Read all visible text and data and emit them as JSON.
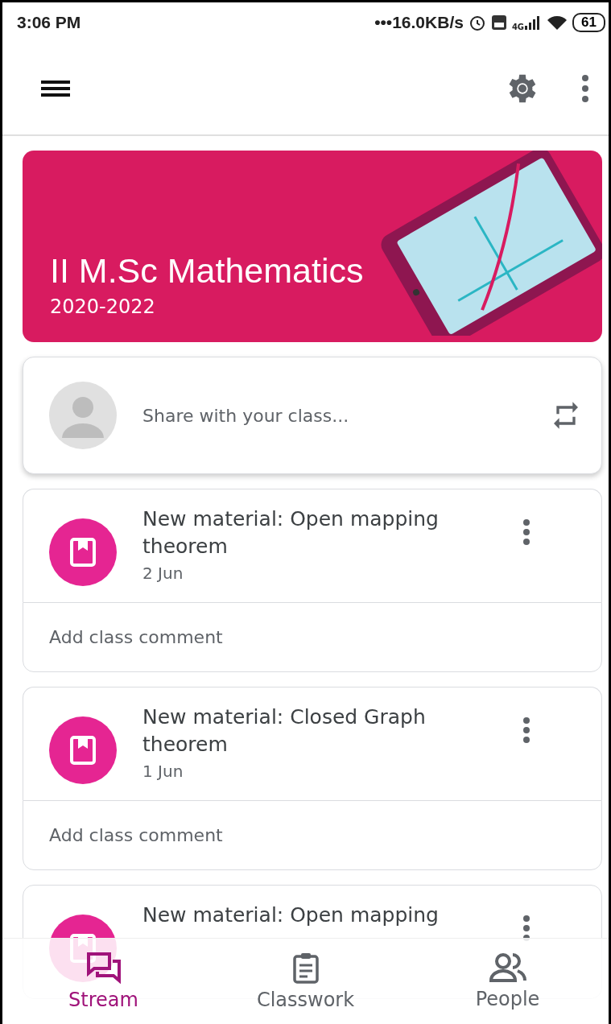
{
  "status_bar": {
    "time": "3:06 PM",
    "speed": "•••16.0KB/s",
    "network_label": "4G",
    "battery": "61"
  },
  "class_banner": {
    "title": "II M.Sc Mathematics",
    "subtitle": "2020-2022"
  },
  "share_box": {
    "placeholder": "Share with your class..."
  },
  "posts": [
    {
      "title": "New material: Open mapping theorem",
      "date": "2 Jun",
      "comment_placeholder": "Add class comment"
    },
    {
      "title": "New material: Closed Graph theorem",
      "date": "1 Jun",
      "comment_placeholder": "Add class comment"
    },
    {
      "title": "New material: Open mapping"
    }
  ],
  "bottom_nav": [
    {
      "kind": "stream",
      "label": "Stream",
      "selected": true
    },
    {
      "kind": "classwork",
      "label": "Classwork",
      "selected": false
    },
    {
      "kind": "people",
      "label": "People",
      "selected": false
    }
  ]
}
